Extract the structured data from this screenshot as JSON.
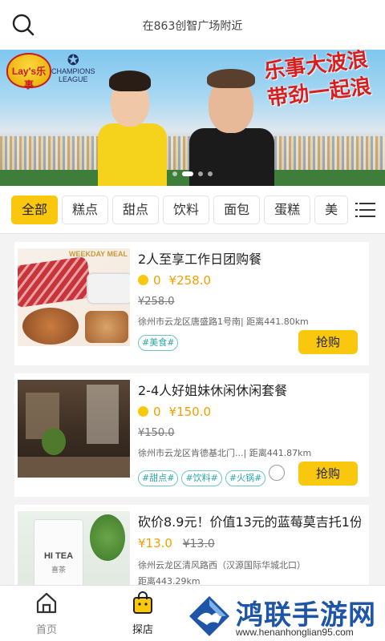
{
  "header": {
    "location_text": "在863创智广场附近",
    "search_icon": "search-icon"
  },
  "banner": {
    "brand_logo": "Lay's乐事",
    "league_logo_line1": "CHAMPIONS",
    "league_logo_line2": "LEAGUE",
    "slogan_line1": "乐事大波浪",
    "slogan_line2": "带劲一起浪",
    "carousel_total": 4,
    "carousel_active": 1
  },
  "categories": {
    "items": [
      "全部",
      "糕点",
      "甜点",
      "饮料",
      "面包",
      "蛋糕",
      "美"
    ],
    "active_index": 0,
    "menu_icon": "list-menu-icon"
  },
  "deals": [
    {
      "title": "2人至享工作日团购餐",
      "points": "0",
      "price": "¥258.0",
      "original_price": "¥258.0",
      "address": "徐州市云龙区唐盛路1号南| 距离441.80km",
      "tags": [
        "#美食#"
      ],
      "buy_label": "抢购",
      "image_text": "WEEKDAY MEAL"
    },
    {
      "title": "2-4人好姐妹休闲休闲套餐",
      "points": "0",
      "price": "¥150.0",
      "original_price": "¥150.0",
      "address": "徐州市云龙区肯德基北门...| 距离441.87km",
      "tags": [
        "#甜点#",
        "#饮料#",
        "#火锅#"
      ],
      "buy_label": "抢购"
    },
    {
      "title": "砍价8.9元！价值13元的蓝莓莫吉托1份",
      "price": "¥13.0",
      "original_price": "¥13.0",
      "address": "徐州云龙区清风路西（汉源国际华城北口）",
      "distance": "距离443.29km",
      "image_text": "HI TEA",
      "image_subtext": "喜茶"
    }
  ],
  "tabbar": {
    "tabs": [
      {
        "label": "首页",
        "icon": "home-icon"
      },
      {
        "label": "探店",
        "icon": "shopping-bag-icon"
      }
    ],
    "active_index": 1
  },
  "watermark": {
    "text": "鸿联手游网",
    "url": "www.henanhonglian95.com"
  },
  "colors": {
    "accent": "#f9c80e",
    "price": "#f0a000",
    "tag": "#2aa7a7"
  }
}
